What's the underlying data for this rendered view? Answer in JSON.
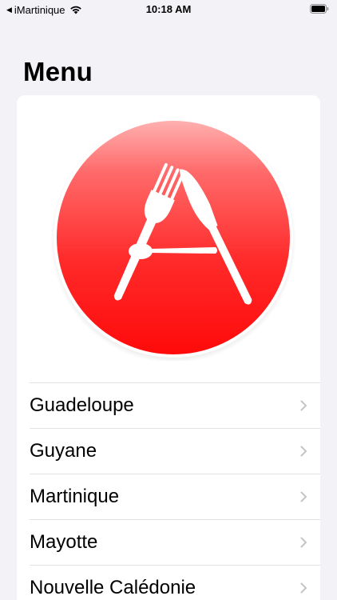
{
  "status_bar": {
    "back_app": "iMartinique",
    "time": "10:18 AM",
    "icons": [
      "back-triangle-icon",
      "wifi-icon",
      "battery-icon"
    ]
  },
  "page": {
    "title": "Menu"
  },
  "logo": {
    "icon": "fork-knife-spoon-logo",
    "background_color": "#ff1a1a",
    "glyph_color": "#ffffff"
  },
  "list": {
    "items": [
      {
        "label": "Guadeloupe",
        "icon": "chevron-right-icon"
      },
      {
        "label": "Guyane",
        "icon": "chevron-right-icon"
      },
      {
        "label": "Martinique",
        "icon": "chevron-right-icon"
      },
      {
        "label": "Mayotte",
        "icon": "chevron-right-icon"
      },
      {
        "label": "Nouvelle Calédonie",
        "icon": "chevron-right-icon"
      }
    ]
  },
  "colors": {
    "background": "#f2f2f7",
    "card": "#ffffff",
    "separator": "#e2e2e6",
    "chevron": "#c4c4c7"
  }
}
